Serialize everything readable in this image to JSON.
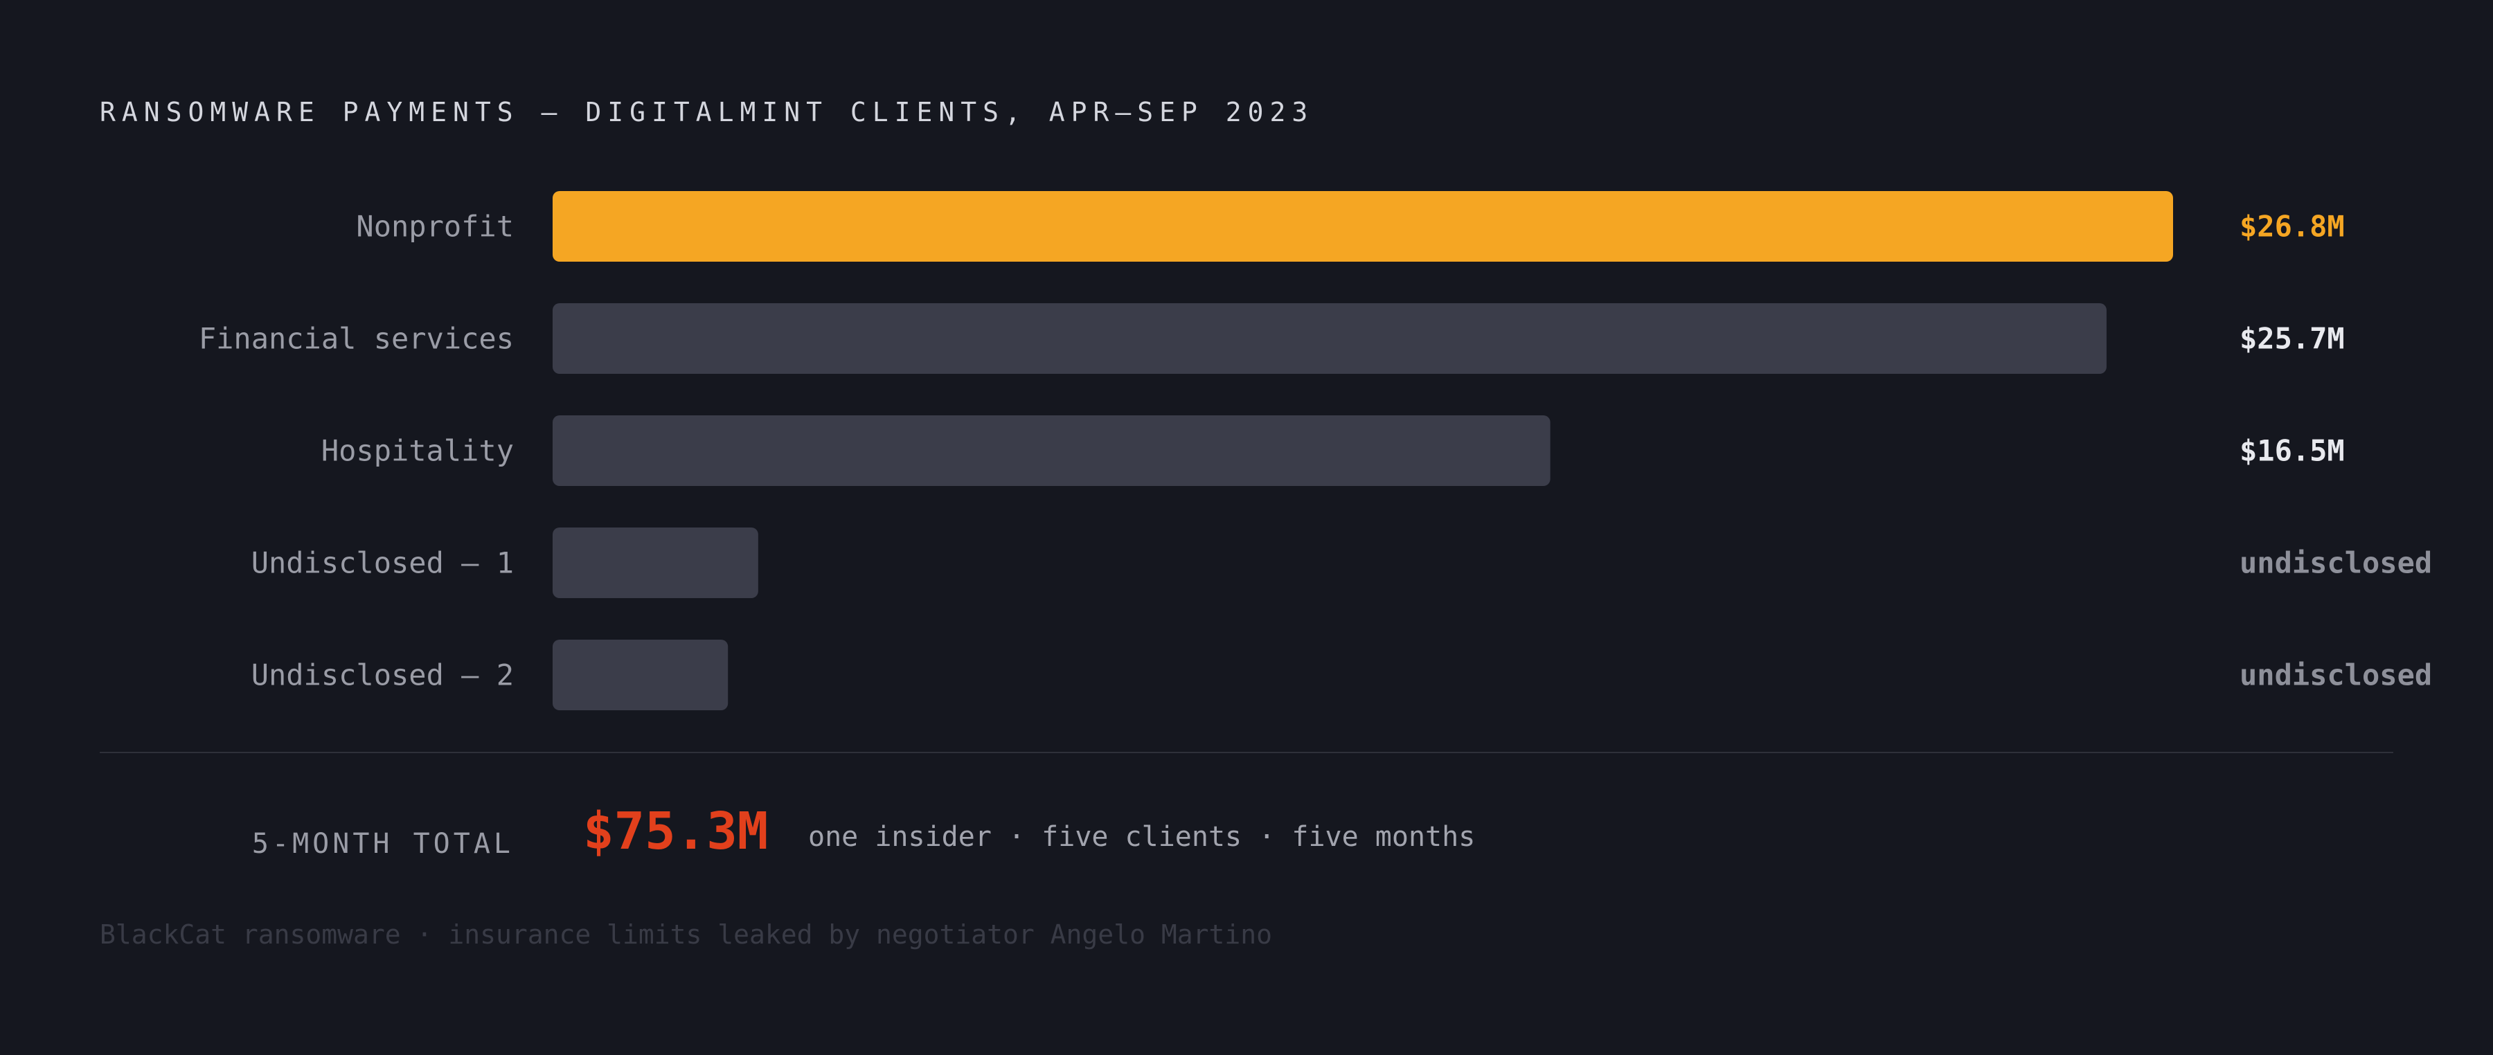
{
  "title": "RANSOMWARE PAYMENTS — DIGITALMINT CLIENTS, APR–SEP 2023",
  "chart_data": {
    "type": "bar",
    "orientation": "horizontal",
    "title": "RANSOMWARE PAYMENTS — DIGITALMINT CLIENTS, APR–SEP 2023",
    "categories": [
      "Nonprofit",
      "Financial services",
      "Hospitality",
      "Undisclosed — 1",
      "Undisclosed — 2"
    ],
    "values": [
      26.8,
      25.7,
      16.5,
      3.4,
      2.9
    ],
    "value_labels": [
      "$26.8M",
      "$25.7M",
      "$16.5M",
      "undisclosed",
      "undisclosed"
    ],
    "highlight_index": 0,
    "xlim": [
      0,
      26.8
    ],
    "grid": false,
    "legend": "none",
    "colors": {
      "highlight": "#f5a623",
      "bar": "#3b3d4a",
      "value_default": "#e8e9ee",
      "value_undisclosed": "#8e909a"
    }
  },
  "summary": {
    "label": "5-MONTH TOTAL",
    "value": "$75.3M",
    "note": "one insider · five clients · five months",
    "value_color": "#e2401c"
  },
  "footnote": "BlackCat ransomware · insurance limits leaked by negotiator Angelo Martino"
}
